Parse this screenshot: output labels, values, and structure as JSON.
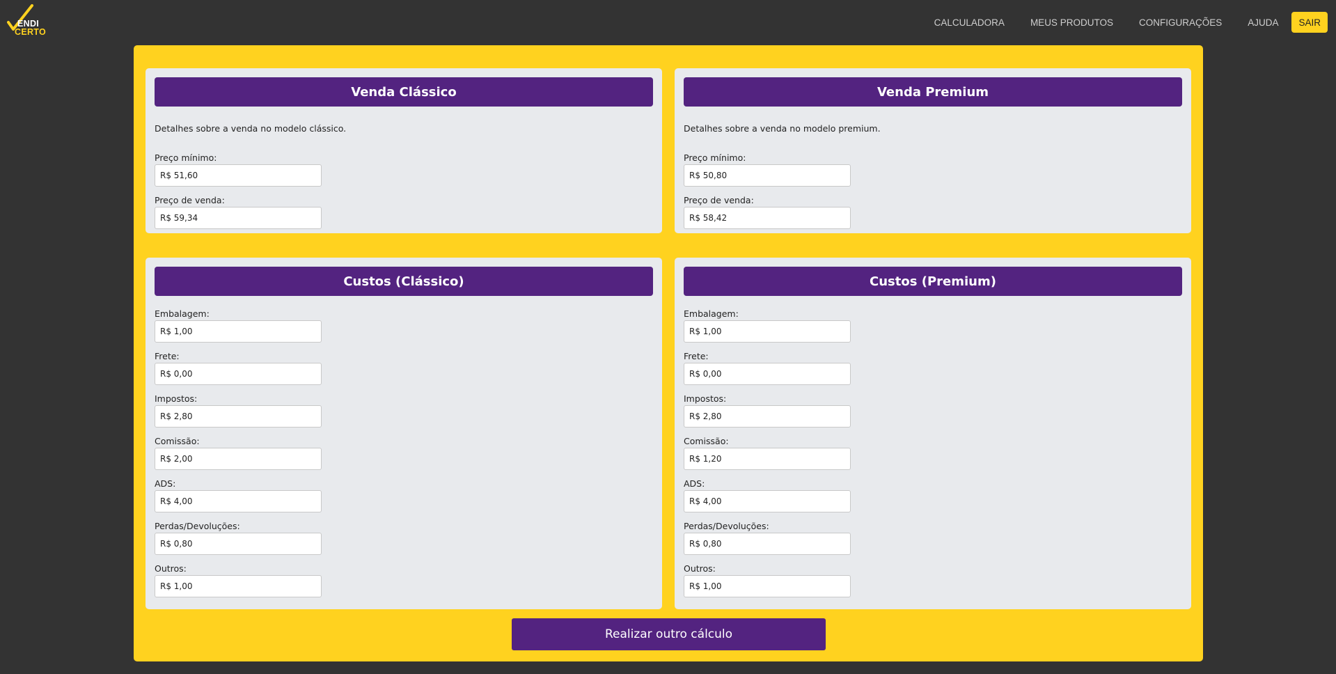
{
  "logo": {
    "line1": "ENDI",
    "line2": "CERTO"
  },
  "nav": {
    "items": [
      "CALCULADORA",
      "MEUS PRODUTOS",
      "CONFIGURAÇÕES",
      "AJUDA"
    ],
    "logout_label": "SAIR"
  },
  "colors": {
    "background": "#333333",
    "accent": "#ffd21f",
    "primary": "#532380",
    "card": "#e8eaed"
  },
  "venda_classico": {
    "title": "Venda Clássico",
    "description": "Detalhes sobre a venda no modelo clássico.",
    "fields": [
      {
        "label": "Preço mínimo:",
        "value": "R$ 51,60"
      },
      {
        "label": "Preço de venda:",
        "value": "R$ 59,34"
      }
    ]
  },
  "venda_premium": {
    "title": "Venda Premium",
    "description": "Detalhes sobre a venda no modelo premium.",
    "fields": [
      {
        "label": "Preço mínimo:",
        "value": "R$ 50,80"
      },
      {
        "label": "Preço de venda:",
        "value": "R$ 58,42"
      }
    ]
  },
  "custos_classico": {
    "title": "Custos (Clássico)",
    "fields": [
      {
        "label": "Embalagem:",
        "value": "R$ 1,00"
      },
      {
        "label": "Frete:",
        "value": "R$ 0,00"
      },
      {
        "label": "Impostos:",
        "value": "R$ 2,80"
      },
      {
        "label": "Comissão:",
        "value": "R$ 2,00"
      },
      {
        "label": "ADS:",
        "value": "R$ 4,00"
      },
      {
        "label": "Perdas/Devoluções:",
        "value": "R$ 0,80"
      },
      {
        "label": "Outros:",
        "value": "R$ 1,00"
      }
    ]
  },
  "custos_premium": {
    "title": "Custos (Premium)",
    "fields": [
      {
        "label": "Embalagem:",
        "value": "R$ 1,00"
      },
      {
        "label": "Frete:",
        "value": "R$ 0,00"
      },
      {
        "label": "Impostos:",
        "value": "R$ 2,80"
      },
      {
        "label": "Comissão:",
        "value": "R$ 1,20"
      },
      {
        "label": "ADS:",
        "value": "R$ 4,00"
      },
      {
        "label": "Perdas/Devoluções:",
        "value": "R$ 0,80"
      },
      {
        "label": "Outros:",
        "value": "R$ 1,00"
      }
    ]
  },
  "actions": {
    "recalculate_label": "Realizar outro cálculo"
  }
}
